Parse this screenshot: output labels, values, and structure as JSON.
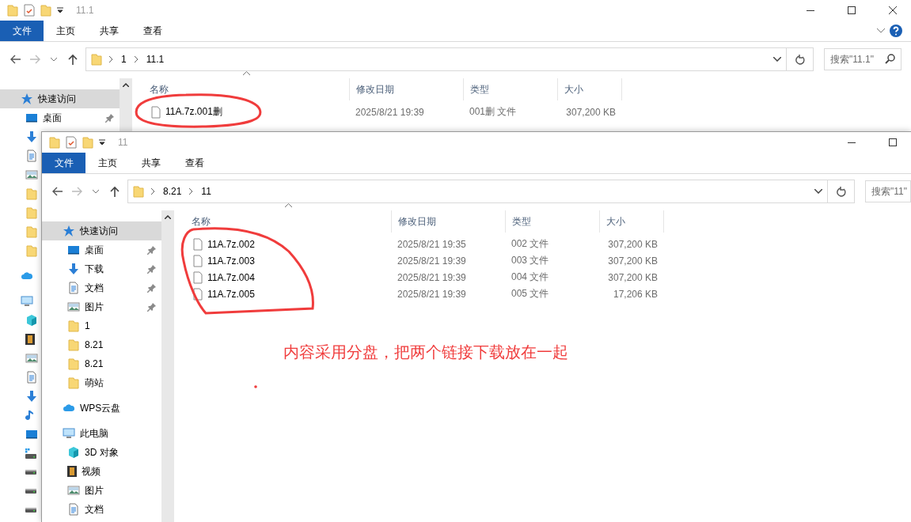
{
  "back_window": {
    "title": "11.1",
    "title_buttons": [
      {
        "kind": "minimize"
      },
      {
        "kind": "maximize"
      },
      {
        "kind": "close"
      }
    ],
    "ribbon_controls": [
      {
        "kind": "expand"
      },
      {
        "kind": "help"
      }
    ],
    "tabs": [
      {
        "label": "文件",
        "selected": true
      },
      {
        "label": "主页",
        "selected": false
      },
      {
        "label": "共享",
        "selected": false
      },
      {
        "label": "查看",
        "selected": false
      }
    ],
    "path": [
      "1",
      "11.1"
    ],
    "search": {
      "placeholder": "搜索\"11.1\"",
      "icon": true
    },
    "sidebar": [
      {
        "kind": "star",
        "label": "快速访问",
        "selected": true,
        "children": [
          {
            "kind": "desktop",
            "label": "桌面",
            "pinned": true,
            "selected": false
          },
          {
            "kind": "download",
            "selected": false
          },
          {
            "kind": "document",
            "selected": false
          },
          {
            "kind": "picture",
            "selected": false
          },
          {
            "kind": "folder",
            "selected": false
          },
          {
            "kind": "folder",
            "selected": false
          },
          {
            "kind": "folder",
            "selected": false
          },
          {
            "kind": "folder",
            "selected": false
          }
        ]
      },
      {
        "kind": "cloud",
        "selected": false
      },
      {
        "kind": "pc",
        "selected": false,
        "children": [
          {
            "kind": "cube",
            "selected": false
          },
          {
            "kind": "video",
            "selected": false
          },
          {
            "kind": "picture",
            "selected": false
          },
          {
            "kind": "document",
            "selected": false
          },
          {
            "kind": "download",
            "selected": false
          },
          {
            "kind": "music",
            "selected": false
          },
          {
            "kind": "desktop",
            "selected": false
          },
          {
            "kind": "drive_win",
            "selected": false
          },
          {
            "kind": "drive",
            "selected": false
          },
          {
            "kind": "drive",
            "selected": false
          },
          {
            "kind": "drive",
            "selected": false
          }
        ]
      }
    ],
    "columns": [
      "名称",
      "修改日期",
      "类型",
      "大小"
    ],
    "files": [
      {
        "name": "11A.7z.001删",
        "date": "2025/8/21 19:39",
        "type": "001删 文件",
        "size": "307,200 KB"
      }
    ]
  },
  "front_window": {
    "title": "11",
    "title_buttons": [
      {
        "kind": "minimize"
      },
      {
        "kind": "maximize"
      }
    ],
    "tabs": [
      {
        "label": "文件",
        "selected": true
      },
      {
        "label": "主页",
        "selected": false
      },
      {
        "label": "共享",
        "selected": false
      },
      {
        "label": "查看",
        "selected": false
      }
    ],
    "path": [
      "8.21",
      "11"
    ],
    "search": {
      "placeholder": "搜索\"11\"",
      "icon": false
    },
    "sidebar": [
      {
        "kind": "star",
        "label": "快速访问",
        "selected": true,
        "children": [
          {
            "kind": "desktop",
            "label": "桌面",
            "pinned": true,
            "selected": false
          },
          {
            "kind": "download",
            "label": "下载",
            "pinned": true,
            "selected": false
          },
          {
            "kind": "document",
            "label": "文档",
            "pinned": true,
            "selected": false
          },
          {
            "kind": "picture",
            "label": "图片",
            "pinned": true,
            "selected": false
          },
          {
            "kind": "folder",
            "label": "1",
            "pinned": false,
            "selected": false
          },
          {
            "kind": "folder",
            "label": "8.21",
            "pinned": false,
            "selected": false
          },
          {
            "kind": "folder",
            "label": "8.21",
            "pinned": false,
            "selected": false
          },
          {
            "kind": "folder",
            "label": "萌站",
            "pinned": false,
            "selected": false
          }
        ]
      },
      {
        "kind": "cloud",
        "label": "WPS云盘",
        "selected": false
      },
      {
        "kind": "pc",
        "label": "此电脑",
        "selected": false,
        "children": [
          {
            "kind": "cube",
            "label": "3D 对象",
            "pinned": false,
            "selected": false
          },
          {
            "kind": "video",
            "label": "视频",
            "pinned": false,
            "selected": false
          },
          {
            "kind": "picture",
            "label": "图片",
            "pinned": false,
            "selected": false
          },
          {
            "kind": "document",
            "label": "文档",
            "pinned": false,
            "selected": false
          }
        ]
      }
    ],
    "columns": [
      "名称",
      "修改日期",
      "类型",
      "大小"
    ],
    "files": [
      {
        "name": "11A.7z.002",
        "date": "2025/8/21 19:35",
        "type": "002 文件",
        "size": "307,200 KB"
      },
      {
        "name": "11A.7z.003",
        "date": "2025/8/21 19:39",
        "type": "003 文件",
        "size": "307,200 KB"
      },
      {
        "name": "11A.7z.004",
        "date": "2025/8/21 19:39",
        "type": "004 文件",
        "size": "307,200 KB"
      },
      {
        "name": "11A.7z.005",
        "date": "2025/8/21 19:39",
        "type": "005 文件",
        "size": "17,206 KB"
      }
    ],
    "annotation_text": "内容采用分盘，把两个链接下载放在一起"
  }
}
